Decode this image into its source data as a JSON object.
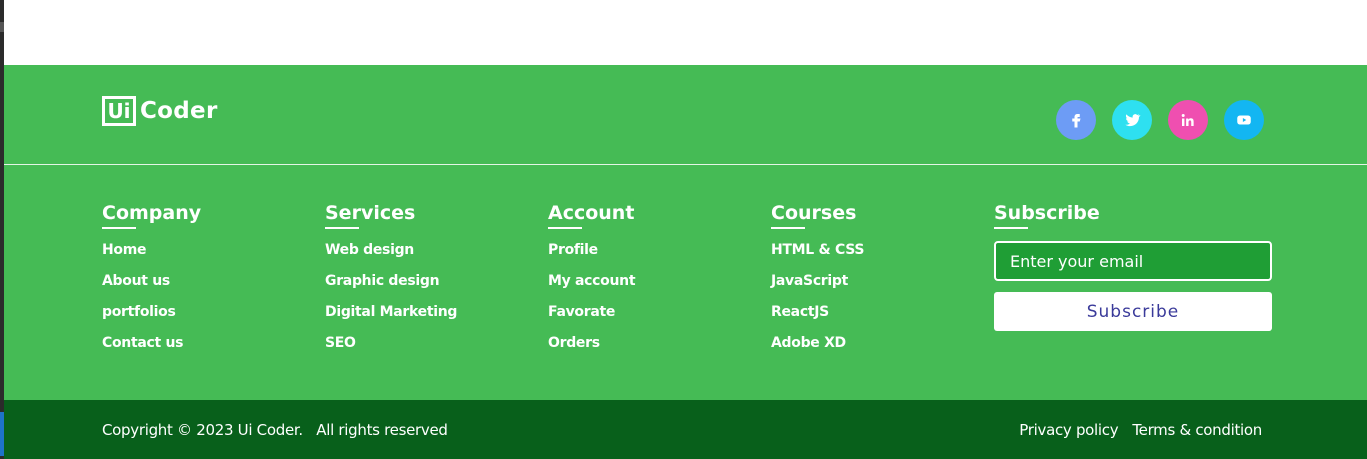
{
  "logo": {
    "mark": "Ui",
    "name": "Coder"
  },
  "socials": [
    {
      "name": "facebook-icon",
      "color": "#6d9cf5"
    },
    {
      "name": "twitter-icon",
      "color": "#2ee0f0"
    },
    {
      "name": "linkedin-icon",
      "color": "#ef4fb0",
      "glyph": "in"
    },
    {
      "name": "youtube-icon",
      "color": "#13b6f2"
    }
  ],
  "columns": [
    {
      "title": "Company",
      "items": [
        "Home",
        "About us",
        "portfolios",
        "Contact us"
      ]
    },
    {
      "title": "Services",
      "items": [
        "Web design",
        "Graphic design",
        "Digital Marketing",
        "SEO"
      ]
    },
    {
      "title": "Account",
      "items": [
        "Profile",
        "My account",
        "Favorate",
        "Orders"
      ]
    },
    {
      "title": "Courses",
      "items": [
        "HTML & CSS",
        "JavaScript",
        "ReactJS",
        "Adobe XD"
      ]
    }
  ],
  "subscribe": {
    "title": "Subscribe",
    "placeholder": "Enter your email",
    "button": "Subscribe"
  },
  "bottom": {
    "copyright": "Copyright © 2023 Ui Coder.   All rights reserved",
    "links": [
      "Privacy policy",
      "Terms & condition"
    ]
  },
  "colors": {
    "footer_main": "#45bb55",
    "footer_bottom": "#08601b",
    "input_bg": "#1f9e35"
  }
}
